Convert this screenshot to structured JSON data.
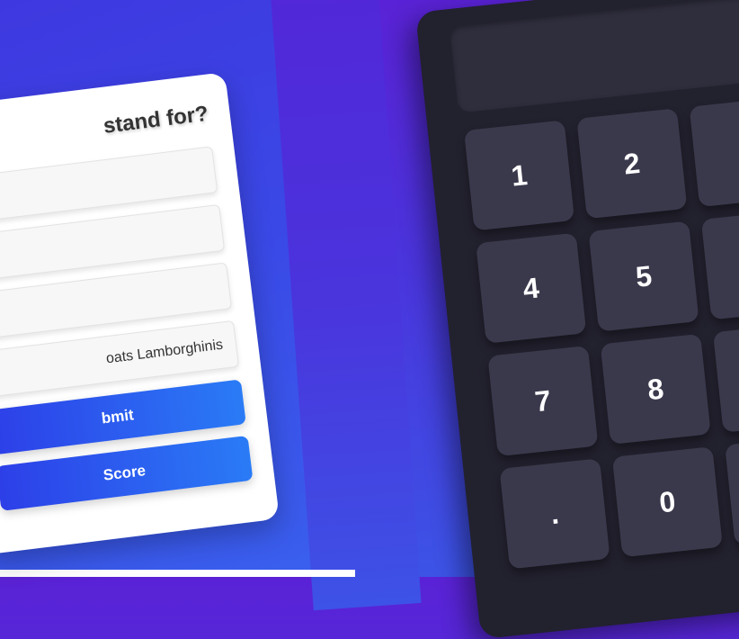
{
  "quiz": {
    "question": "stand for?",
    "options": [
      "",
      "",
      "",
      "oats Lamborghinis"
    ],
    "submit_label": "bmit",
    "score_label": "Score"
  },
  "calculator": {
    "keys": [
      {
        "label": "1"
      },
      {
        "label": "2"
      },
      {
        "label": ""
      },
      {
        "label": "4"
      },
      {
        "label": "5"
      },
      {
        "label": ""
      },
      {
        "label": "7"
      },
      {
        "label": "8"
      },
      {
        "label": ""
      },
      {
        "label": "."
      },
      {
        "label": "0"
      },
      {
        "label": ""
      }
    ]
  },
  "colors": {
    "accent_gradient_start": "#2d3fe8",
    "accent_gradient_end": "#2a7bf6",
    "calc_body": "#22212e",
    "calc_key": "#3a394c"
  }
}
